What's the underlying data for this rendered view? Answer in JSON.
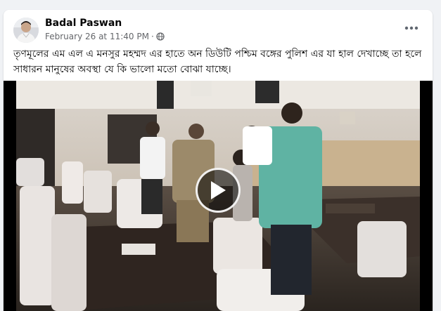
{
  "post": {
    "author": "Badal Paswan",
    "timestamp": "February 26 at 11:40 PM",
    "separator": "·",
    "privacy_icon": "globe-icon",
    "more_icon": "more-options-icon",
    "caption": "তৃণমূলের এম এল এ মনসুর মহম্মদ  এর হাতে অন ডিউটি পশ্চিম বঙ্গের পুলিশ এর যা হাল দেখাচ্ছে তা হলে সাধারন মানুষের অবস্থা যে কি ভালো মতো বোঝা যাচ্ছে।"
  },
  "video": {
    "play_icon": "play-icon"
  },
  "colors": {
    "page_background": "#f0f2f5",
    "card_background": "#ffffff",
    "primary_text": "#050505",
    "secondary_text": "#65676b",
    "video_background": "#000000"
  }
}
